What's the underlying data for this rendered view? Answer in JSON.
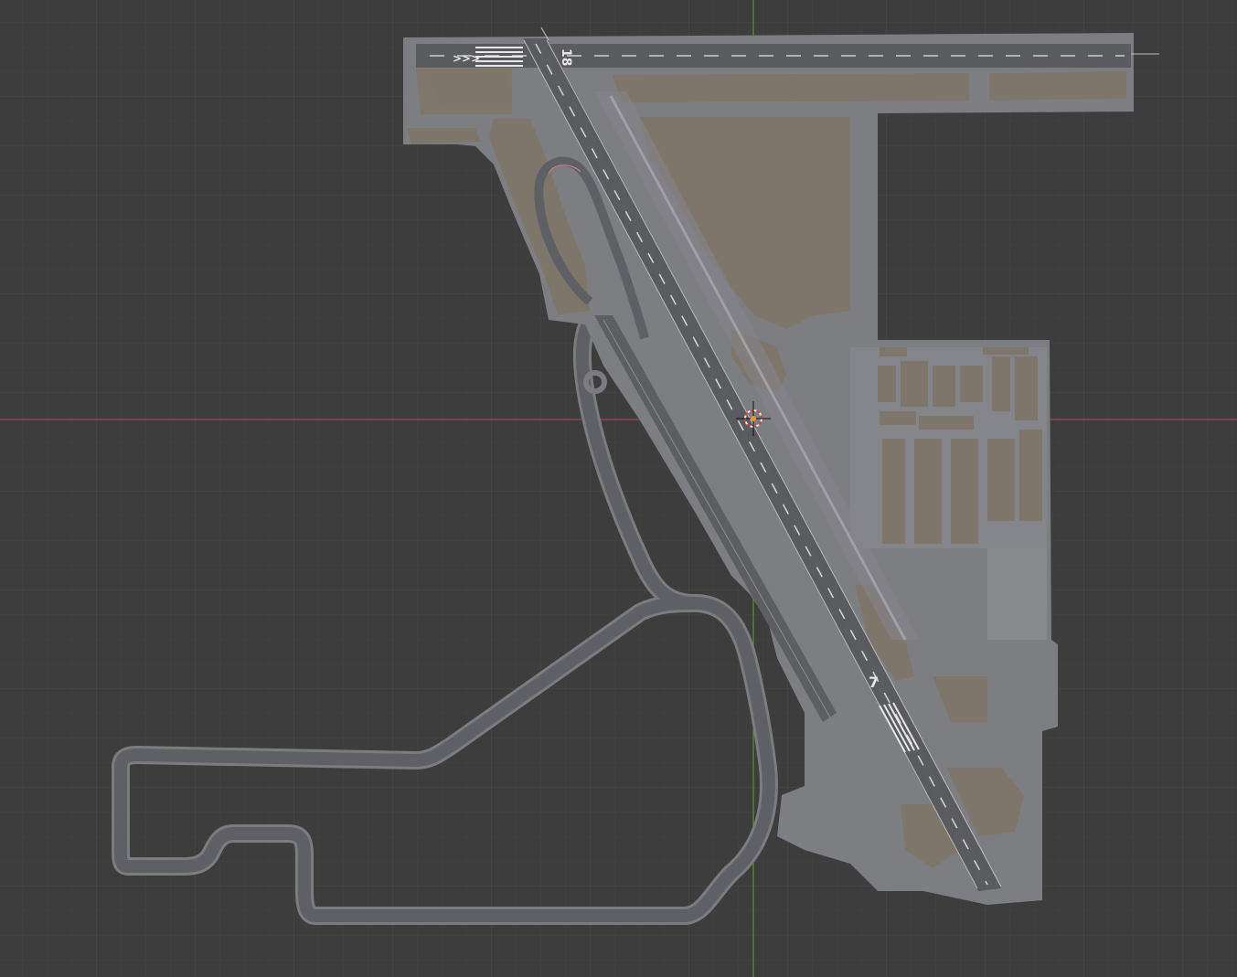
{
  "viewport": {
    "background": "#3d3d3d",
    "grid_minor": "#454545",
    "grid_major": "#4c4c4c",
    "axis_x_color": "#b44a4a",
    "axis_y_color": "#6f9a2c",
    "cursor_icon": "3d-cursor-icon"
  },
  "scene": {
    "paved_color": "#7d7e82",
    "grass_color": "#7f766b",
    "runway_color": "#5a5b5f",
    "road_color": "#606166",
    "road_edge_color": "#7a7b80",
    "runway_a_number": "18",
    "runway_b_number": "7"
  }
}
